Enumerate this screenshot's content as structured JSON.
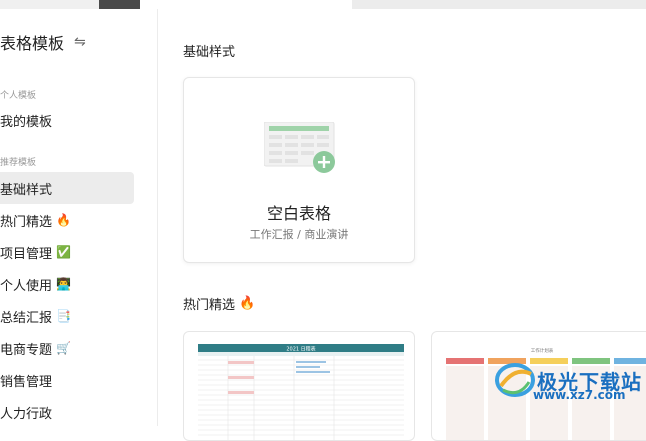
{
  "sidebar": {
    "title": "表格模板",
    "swap_icon": "⇋",
    "section_personal": "个人模板",
    "my_templates": "我的模板",
    "section_recommended": "推荐模板",
    "items": [
      {
        "label": "基础样式",
        "emoji": ""
      },
      {
        "label": "热门精选",
        "emoji": "🔥"
      },
      {
        "label": "项目管理",
        "emoji": "✅"
      },
      {
        "label": "个人使用",
        "emoji": "👨‍💻"
      },
      {
        "label": "总结汇报",
        "emoji": "📑"
      },
      {
        "label": "电商专题",
        "emoji": "🛒"
      },
      {
        "label": "销售管理",
        "emoji": ""
      },
      {
        "label": "人力行政",
        "emoji": ""
      }
    ]
  },
  "main": {
    "section_basic": "基础样式",
    "blank_card": {
      "title": "空白表格",
      "subtitle": "工作汇报 / 商业演讲"
    },
    "section_hot": "热门精选",
    "section_hot_emoji": "🔥",
    "hot_card_1_header": "2021 日程表",
    "hot_card_2_header": "工作计划表"
  },
  "watermark": {
    "text": "极光下载站",
    "url": "www.xz7.com"
  },
  "colors": {
    "accent_green": "#5cb85c",
    "sheet_header": "#9fd3a9",
    "active_bg": "#ececec",
    "teal_header": "#2f7d86"
  }
}
